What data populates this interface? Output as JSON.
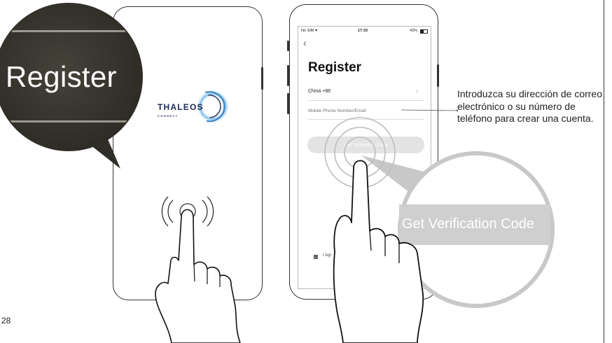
{
  "page_number": "28",
  "left_phone": {
    "brand": {
      "name": "THALEOS",
      "tagline": "CONNECT"
    },
    "magnifier_label": "Register"
  },
  "right_phone": {
    "status_bar": {
      "carrier": "No SIM",
      "time": "17:33",
      "battery": "43%"
    },
    "back_icon": "chevron-left",
    "title": "Register",
    "country_code": "China +86",
    "phone_placeholder": "Mobile Phone Number/Email",
    "verification_button": "Get Verification Code",
    "agreement_text": "I Agr"
  },
  "callout_text": "Introduzca su dirección de correo electrónico o su número de teléfono para crear una cuenta.",
  "zoom_label": "Get Verification Code",
  "colors": {
    "brand_navy": "#1b2a55",
    "brand_blue": "#3b86c6",
    "magnifier_dark": "#3a372e",
    "zoom_gray": "#c8c8c8"
  }
}
